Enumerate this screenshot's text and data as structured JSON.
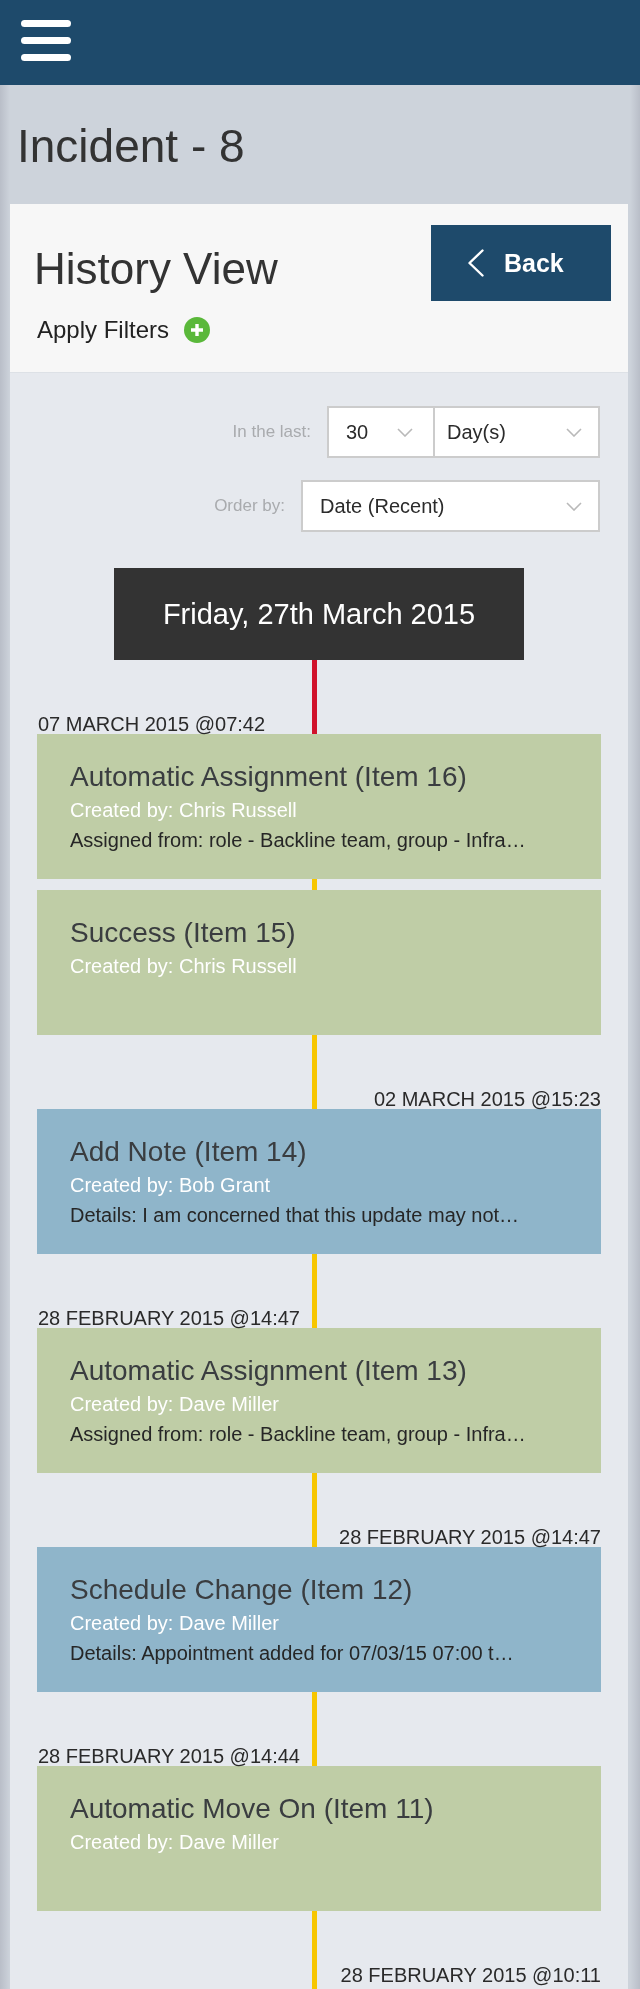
{
  "page_title": "Incident - 8",
  "panel": {
    "title": "History View",
    "back_button": "Back",
    "filter_link": "Apply Filters"
  },
  "filters": [
    {
      "label": "In the last:",
      "values": [
        "30",
        "Day(s)"
      ]
    },
    {
      "label": "Order by:",
      "values": [
        "Date (Recent)"
      ]
    }
  ],
  "timeline": {
    "date_banner": "Friday, 27th March 2015",
    "entries": [
      {
        "kind": "system",
        "timestamp": "07 MARCH 2015 @07:42",
        "title": "Automatic Assignment (Item 16)",
        "created_by": "Created by: Chris Russell",
        "details": "Assigned from: role - Backline team, group - Infra…"
      },
      {
        "kind": "system",
        "title": "Success (Item 15)",
        "created_by": "Created by: Chris Russell"
      },
      {
        "kind": "user",
        "timestamp": "02 MARCH 2015 @15:23",
        "title": "Add Note (Item 14)",
        "created_by": "Created by: Bob Grant",
        "details": "Details: I am concerned that this update may not…"
      },
      {
        "kind": "system",
        "timestamp": "28 FEBRUARY 2015 @14:47",
        "title": "Automatic Assignment (Item 13)",
        "created_by": "Created by: Dave Miller",
        "details": "Assigned from: role - Backline team, group - Infra…"
      },
      {
        "kind": "user",
        "timestamp": "28 FEBRUARY 2015 @14:47",
        "title": "Schedule Change (Item 12)",
        "created_by": "Created by: Dave Miller",
        "details": "Details: Appointment added for 07/03/15 07:00 t…"
      },
      {
        "kind": "system",
        "timestamp": "28 FEBRUARY 2015 @14:44",
        "title": "Automatic Move On (Item 11)",
        "created_by": "Created by: Dave Miller"
      },
      {
        "kind": "user",
        "timestamp": "28 FEBRUARY 2015 @10:11"
      }
    ]
  }
}
